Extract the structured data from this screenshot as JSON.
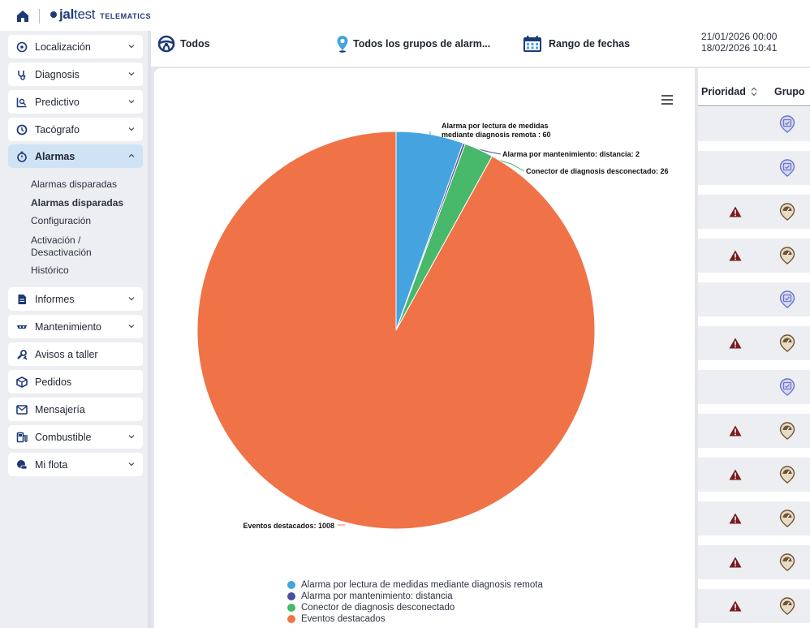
{
  "app": {
    "brand_bold": "jal",
    "brand_light": "test",
    "brand_sub": "TELEMATICS"
  },
  "sidebar": {
    "items": [
      {
        "label": "Localización",
        "icon": "location-pin-icon"
      },
      {
        "label": "Diagnosis",
        "icon": "stethoscope-icon"
      },
      {
        "label": "Predictivo",
        "icon": "predictive-chart-icon"
      },
      {
        "label": "Tacógrafo",
        "icon": "tachograph-icon"
      },
      {
        "label": "Alarmas",
        "icon": "stopwatch-icon"
      },
      {
        "label": "Informes",
        "icon": "document-icon"
      },
      {
        "label": "Mantenimiento",
        "icon": "maintenance-icon"
      },
      {
        "label": "Avisos a taller",
        "icon": "wrench-icon"
      },
      {
        "label": "Pedidos",
        "icon": "package-icon"
      },
      {
        "label": "Mensajería",
        "icon": "message-icon"
      },
      {
        "label": "Combustible",
        "icon": "fuel-icon"
      },
      {
        "label": "Mi flota",
        "icon": "fleet-icon"
      }
    ],
    "alarmas_submenu": [
      "Alarmas disparadas",
      "Alarmas disparadas",
      "Configuración",
      "Activación /\nDesactivación",
      "Histórico"
    ]
  },
  "filters": {
    "vehicles": "Todos",
    "alarm_groups": "Todos los grupos de alarm...",
    "date_range": "Rango de fechas",
    "date_from": "21/01/2026 00:00",
    "date_to": "18/02/2026 10:41"
  },
  "table": {
    "col_priority": "Prioridad",
    "col_group": "Grupo",
    "rows": [
      {
        "alert": false,
        "group": "calendar"
      },
      {
        "alert": false,
        "group": "calendar"
      },
      {
        "alert": true,
        "group": "diagnosis"
      },
      {
        "alert": true,
        "group": "diagnosis"
      },
      {
        "alert": false,
        "group": "calendar"
      },
      {
        "alert": true,
        "group": "diagnosis"
      },
      {
        "alert": false,
        "group": "calendar"
      },
      {
        "alert": true,
        "group": "diagnosis"
      },
      {
        "alert": true,
        "group": "diagnosis"
      },
      {
        "alert": true,
        "group": "diagnosis"
      },
      {
        "alert": true,
        "group": "diagnosis"
      },
      {
        "alert": true,
        "group": "diagnosis"
      },
      {
        "alert": true,
        "group": "diagnosis"
      }
    ]
  },
  "colors": {
    "accent": "#1d3a78",
    "active_nav": "#cfe3f5",
    "alert": "#7a1a1a",
    "group_calendar": "#6b74c9",
    "group_diagnosis": "#6f5538"
  },
  "chart_data": {
    "type": "pie",
    "slices": [
      {
        "name": "Alarma por lectura de medidas mediante diagnosis remota",
        "value": 60,
        "color": "#45a4e0",
        "label_lines": [
          "Alarma por lectura de medidas",
          "mediante diagnosis remota : 60"
        ]
      },
      {
        "name": "Alarma por mantenimiento: distancia",
        "value": 2,
        "color": "#4a4f9c",
        "label_lines": [
          "Alarma por mantenimiento: distancia: 2"
        ]
      },
      {
        "name": "Conector de diagnosis desconectado",
        "value": 26,
        "color": "#48b86b",
        "label_lines": [
          "Conector de diagnosis desconectado: 26"
        ]
      },
      {
        "name": "Eventos destacados",
        "value": 1008,
        "color": "#f07247",
        "label_lines": [
          "Eventos destacados: 1008"
        ]
      }
    ],
    "legend_position": "bottom"
  }
}
